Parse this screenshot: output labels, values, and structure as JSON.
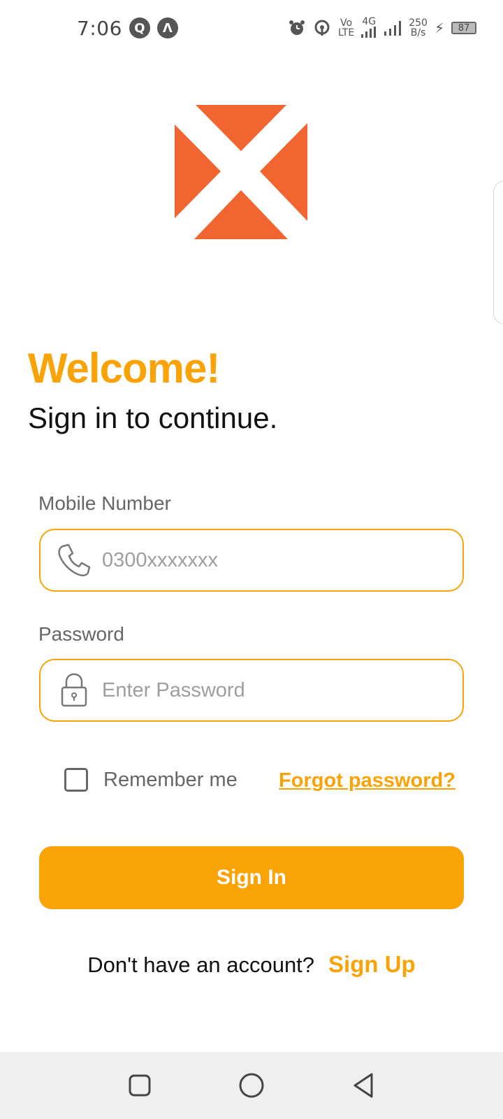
{
  "status_bar": {
    "time": "7:06",
    "left_icons": [
      "q-icon",
      "a-icon"
    ],
    "right_icons": [
      "alarm-icon",
      "hotspot-icon",
      "volte-icon",
      "signal-icon",
      "signal-icon"
    ],
    "volte_top": "Vo",
    "volte_bottom": "LTE",
    "network": "4G",
    "speed_value": "250",
    "speed_unit": "B/s",
    "battery": "87"
  },
  "brand": {
    "logo": "x-logo-icon",
    "color": "#f26531"
  },
  "header": {
    "title": "Welcome!",
    "subtitle": "Sign in to continue."
  },
  "form": {
    "mobile": {
      "label": "Mobile Number",
      "placeholder": "0300xxxxxxx",
      "value": ""
    },
    "password": {
      "label": "Password",
      "placeholder": "Enter Password",
      "value": ""
    },
    "remember_label": "Remember me",
    "remember_checked": false,
    "forgot_label": "Forgot password?",
    "submit_label": "Sign In"
  },
  "footer": {
    "prompt": "Don't have an account?",
    "signup_label": "Sign Up"
  },
  "theme": {
    "accent": "#faa307"
  }
}
